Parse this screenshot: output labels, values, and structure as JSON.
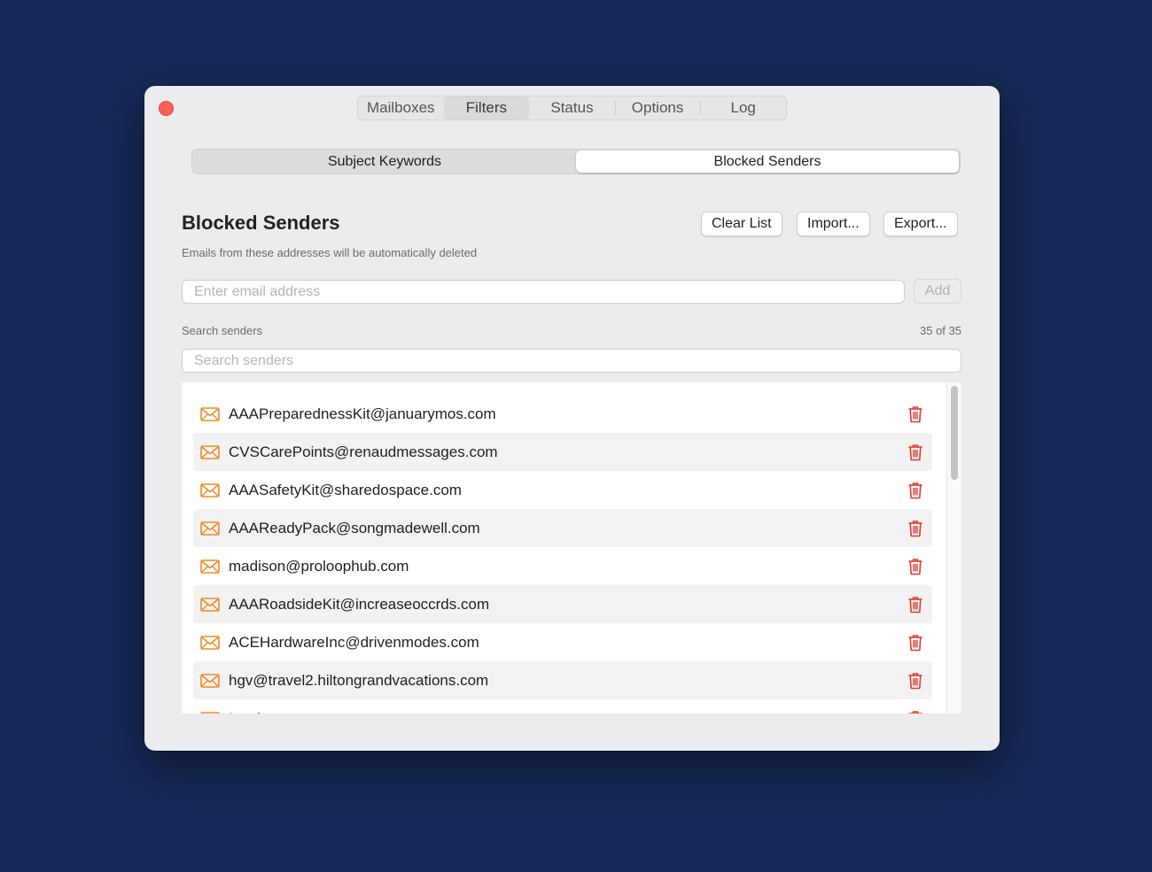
{
  "tabs": [
    "Mailboxes",
    "Filters",
    "Status",
    "Options",
    "Log"
  ],
  "active_tab": "Filters",
  "segments": [
    "Subject Keywords",
    "Blocked Senders"
  ],
  "active_segment": "Blocked Senders",
  "section": {
    "title": "Blocked Senders",
    "subtitle": "Emails from these addresses will be automatically deleted"
  },
  "toolbar": {
    "clear_label": "Clear List",
    "import_label": "Import...",
    "export_label": "Export..."
  },
  "email_input": {
    "placeholder": "Enter email address",
    "value": ""
  },
  "add_label": "Add",
  "search": {
    "label": "Search senders",
    "placeholder": "Search senders",
    "count": "35 of 35"
  },
  "senders": [
    "AAAPreparednessKit@januarymos.com",
    "CVSCarePoints@renaudmessages.com",
    "AAASafetyKit@sharedospace.com",
    "AAAReadyPack@songmadewell.com",
    "madison@proloophub.com",
    "AAARoadsideKit@increaseoccrds.com",
    "ACEHardwareInc@drivenmodes.com",
    "hgv@travel2.hiltongrandvacations.com",
    "Inspire..."
  ],
  "icons": {
    "sender": "envelope-icon",
    "delete": "trash-icon"
  },
  "colors": {
    "envelope": "#f08a24",
    "trash": "#e0392f",
    "close": "#fe5f57",
    "background": "#162a57"
  }
}
